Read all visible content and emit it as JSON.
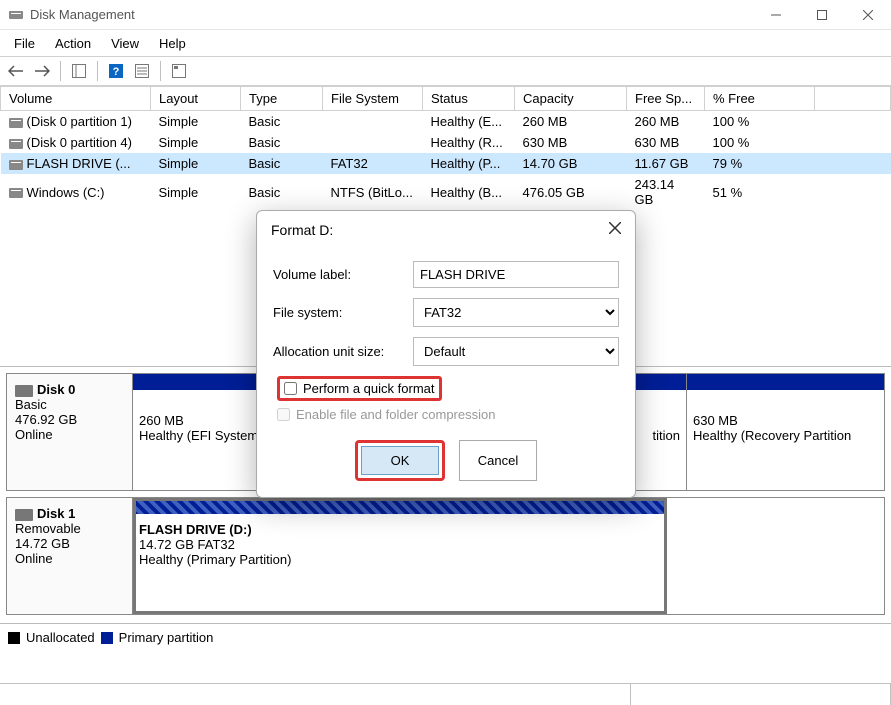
{
  "window": {
    "title": "Disk Management"
  },
  "menu": {
    "file": "File",
    "action": "Action",
    "view": "View",
    "help": "Help"
  },
  "columns": {
    "volume": "Volume",
    "layout": "Layout",
    "type": "Type",
    "fs": "File System",
    "status": "Status",
    "capacity": "Capacity",
    "free": "Free Sp...",
    "pctfree": "% Free"
  },
  "volumes": [
    {
      "name": "(Disk 0 partition 1)",
      "layout": "Simple",
      "type": "Basic",
      "fs": "",
      "status": "Healthy (E...",
      "capacity": "260 MB",
      "free": "260 MB",
      "pct": "100 %"
    },
    {
      "name": "(Disk 0 partition 4)",
      "layout": "Simple",
      "type": "Basic",
      "fs": "",
      "status": "Healthy (R...",
      "capacity": "630 MB",
      "free": "630 MB",
      "pct": "100 %"
    },
    {
      "name": "FLASH DRIVE (...",
      "layout": "Simple",
      "type": "Basic",
      "fs": "FAT32",
      "status": "Healthy (P...",
      "capacity": "14.70 GB",
      "free": "11.67 GB",
      "pct": "79 %"
    },
    {
      "name": "Windows (C:)",
      "layout": "Simple",
      "type": "Basic",
      "fs": "NTFS (BitLo...",
      "status": "Healthy (B...",
      "capacity": "476.05 GB",
      "free": "243.14 GB",
      "pct": "51 %"
    }
  ],
  "disks": {
    "d0": {
      "name": "Disk 0",
      "type": "Basic",
      "size": "476.92 GB",
      "status": "Online",
      "parts": [
        {
          "line1": "",
          "line2": "260 MB",
          "line3": "Healthy (EFI System"
        },
        {
          "line1": "",
          "line2": "",
          "line3": "tition"
        },
        {
          "line1": "",
          "line2": "630 MB",
          "line3": "Healthy (Recovery Partition"
        }
      ]
    },
    "d1": {
      "name": "Disk 1",
      "type": "Removable",
      "size": "14.72 GB",
      "status": "Online",
      "parts": [
        {
          "line1": "FLASH DRIVE  (D:)",
          "line2": "14.72 GB FAT32",
          "line3": "Healthy (Primary Partition)"
        }
      ]
    }
  },
  "legend": {
    "unallocated": "Unallocated",
    "primary": "Primary partition"
  },
  "dialog": {
    "title": "Format D:",
    "volume_label_lbl": "Volume label:",
    "volume_label_val": "FLASH DRIVE",
    "fs_lbl": "File system:",
    "fs_val": "FAT32",
    "aus_lbl": "Allocation unit size:",
    "aus_val": "Default",
    "quick_format": "Perform a quick format",
    "compression": "Enable file and folder compression",
    "ok": "OK",
    "cancel": "Cancel"
  }
}
